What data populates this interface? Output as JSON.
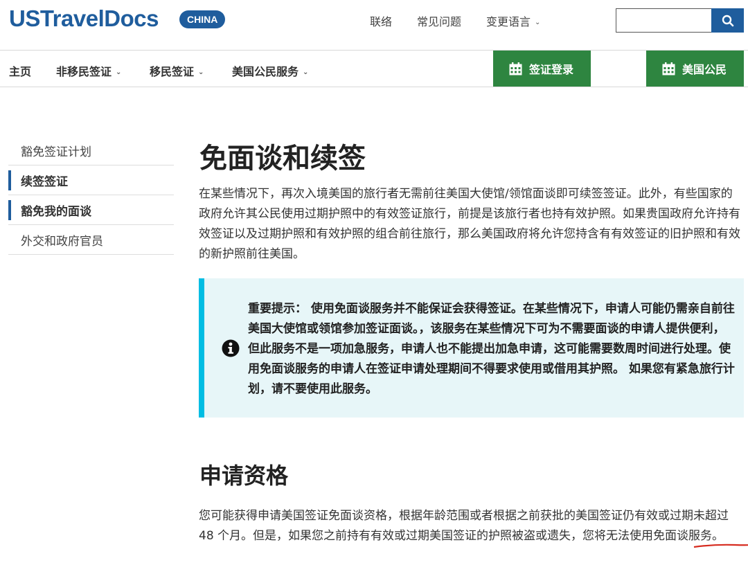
{
  "header": {
    "logo": "USTravelDocs",
    "country_badge": "CHINA",
    "links": {
      "contact": "联络",
      "faq": "常见问题",
      "language": "变更语言"
    },
    "search": {
      "placeholder": ""
    }
  },
  "nav": {
    "home": "主页",
    "nonimmigrant": "非移民签证",
    "immigrant": "移民签证",
    "citizen_services": "美国公民服务",
    "visa_login": "签证登录",
    "us_citizen": "美国公民"
  },
  "sidebar": {
    "items": [
      {
        "label": "豁免签证计划",
        "active": false
      },
      {
        "label": "续签签证",
        "active": true
      },
      {
        "label": "豁免我的面谈",
        "active": true
      },
      {
        "label": "外交和政府官员",
        "active": false
      }
    ]
  },
  "main": {
    "title": "免面谈和续签",
    "intro": "在某些情况下，再次入境美国的旅行者无需前往美国大使馆/领馆面谈即可续签签证。此外，有些国家的政府允许其公民使用过期护照中的有效签证旅行，前提是该旅行者也持有效护照。如果贵国政府允许持有效签证以及过期护照和有效护照的组合前往旅行，那么美国政府将允许您持含有有效签证的旧护照和有效的新护照前往美国。",
    "notice": "重要提示： 使用免面谈服务并不能保证会获得签证。在某些情况下，申请人可能仍需亲自前往美国大使馆或领馆参加签证面谈。，该服务在某些情况下可为不需要面谈的申请人提供便利，但此服务不是一项加急服务，申请人也不能提出加急申请，这可能需要数周时间进行处理。使用免面谈服务的申请人在签证申请处理期间不得要求使用或借用其护照。 如果您有紧急旅行计划，请不要使用此服务。",
    "eligibility_heading": "申请资格",
    "eligibility_before": "您可能获得申请美国签证免面谈资格，根据年龄范围或者根据之前获批的美国签证仍有效或过期",
    "eligibility_highlight": "未超过48 个月。",
    "eligibility_after": "但是，如果您之前持有有效或过期美国签证的护照被盗或遗失，您将无法使用免面谈服务。"
  },
  "colors": {
    "brand_blue": "#1f5d9d",
    "action_green": "#2e8540",
    "notice_bg": "#e7f6f8",
    "notice_accent": "#00bde3",
    "annotation_red": "#d62b1f"
  },
  "icons": [
    "search-icon",
    "calendar-icon",
    "info-icon",
    "chevron-down-icon"
  ]
}
